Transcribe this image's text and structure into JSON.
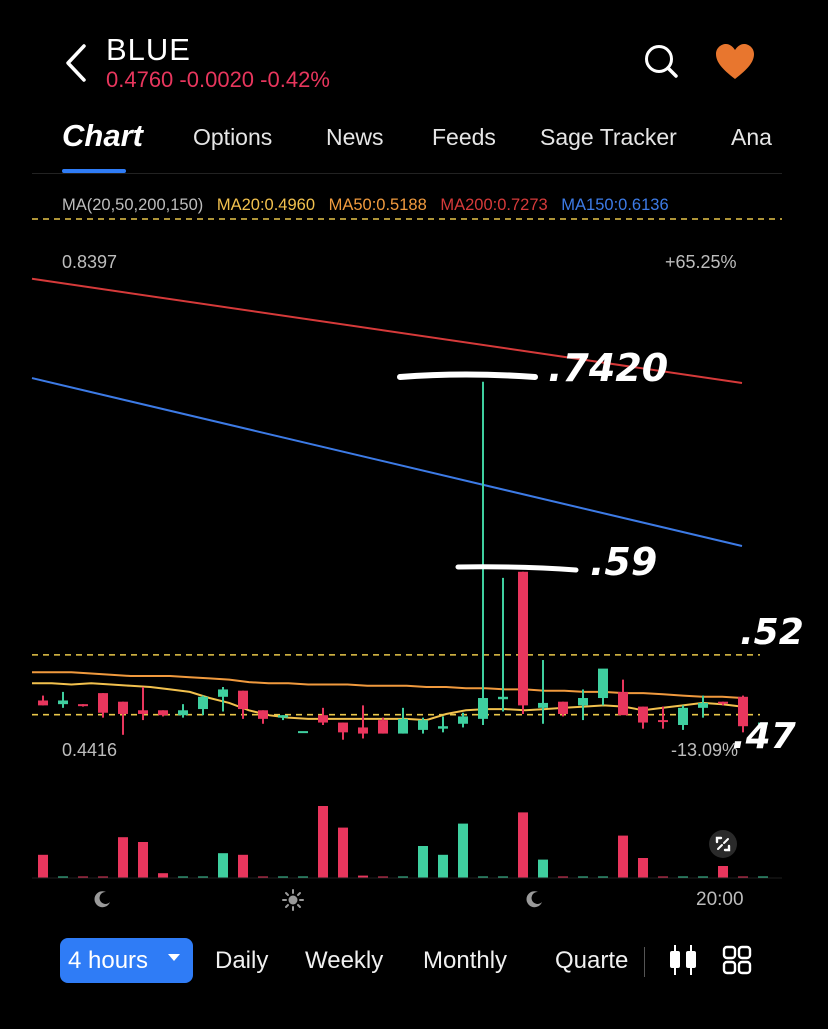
{
  "header": {
    "symbol": "BLUE",
    "price": "0.4760",
    "change": "-0.0020",
    "change_pct": "-0.42%",
    "price_color": "#e8365d"
  },
  "tabs": [
    "Chart",
    "Options",
    "News",
    "Feeds",
    "Sage Tracker",
    "Ana"
  ],
  "active_tab": "Chart",
  "ma_legend": {
    "params": "MA(20,50,200,150)",
    "ma20": "MA20:0.4960",
    "ma50": "MA50:0.5188",
    "ma200": "MA200:0.7273",
    "ma150": "MA150:0.6136",
    "colors": {
      "params": "#bdbdbd",
      "ma20": "#f2c14e",
      "ma50": "#f09a3e",
      "ma200": "#d63a3a",
      "ma150": "#3d7be6"
    }
  },
  "axis": {
    "high": "0.8397",
    "high_pct": "+65.25%",
    "low": "0.4416",
    "low_pct": "-13.09%",
    "time_label": "20:00"
  },
  "annotations": {
    "peak": ".7420",
    "mid": ".59",
    "resistance": ".52",
    "support": ".47"
  },
  "timeframes": {
    "active": "4 hours",
    "items": [
      "Daily",
      "Weekly",
      "Monthly",
      "Quarte"
    ]
  },
  "icons": [
    "back-icon",
    "search-icon",
    "heart-icon",
    "moon-icon",
    "sun-icon",
    "candle-style-icon",
    "grid-icon",
    "fullscreen-icon"
  ],
  "colors": {
    "up": "#3fcf9f",
    "down": "#e8365d",
    "accent": "#2f7cf6",
    "favorite": "#e8762e"
  },
  "chart_data": {
    "type": "candlestick",
    "y_range": [
      0.4416,
      0.8397
    ],
    "candles": [
      {
        "o": 0.482,
        "h": 0.486,
        "l": 0.478,
        "c": 0.478
      },
      {
        "o": 0.479,
        "h": 0.489,
        "l": 0.476,
        "c": 0.482
      },
      {
        "o": 0.479,
        "h": 0.479,
        "l": 0.477,
        "c": 0.478
      },
      {
        "o": 0.488,
        "h": 0.488,
        "l": 0.468,
        "c": 0.472
      },
      {
        "o": 0.481,
        "h": 0.481,
        "l": 0.454,
        "c": 0.471
      },
      {
        "o": 0.474,
        "h": 0.493,
        "l": 0.466,
        "c": 0.471
      },
      {
        "o": 0.474,
        "h": 0.474,
        "l": 0.469,
        "c": 0.47
      },
      {
        "o": 0.47,
        "h": 0.479,
        "l": 0.468,
        "c": 0.474
      },
      {
        "o": 0.475,
        "h": 0.486,
        "l": 0.47,
        "c": 0.485
      },
      {
        "o": 0.485,
        "h": 0.493,
        "l": 0.473,
        "c": 0.491
      },
      {
        "o": 0.49,
        "h": 0.49,
        "l": 0.467,
        "c": 0.475
      },
      {
        "o": 0.474,
        "h": 0.474,
        "l": 0.463,
        "c": 0.467
      },
      {
        "o": 0.468,
        "h": 0.47,
        "l": 0.466,
        "c": 0.47
      },
      {
        "o": 0.457,
        "h": 0.457,
        "l": 0.457,
        "c": 0.457
      },
      {
        "o": 0.47,
        "h": 0.476,
        "l": 0.462,
        "c": 0.464
      },
      {
        "o": 0.464,
        "h": 0.464,
        "l": 0.45,
        "c": 0.456
      },
      {
        "o": 0.46,
        "h": 0.478,
        "l": 0.451,
        "c": 0.455
      },
      {
        "o": 0.466,
        "h": 0.468,
        "l": 0.455,
        "c": 0.455
      },
      {
        "o": 0.455,
        "h": 0.476,
        "l": 0.455,
        "c": 0.467
      },
      {
        "o": 0.458,
        "h": 0.468,
        "l": 0.455,
        "c": 0.466
      },
      {
        "o": 0.459,
        "h": 0.469,
        "l": 0.456,
        "c": 0.461
      },
      {
        "o": 0.463,
        "h": 0.472,
        "l": 0.46,
        "c": 0.469
      },
      {
        "o": 0.467,
        "h": 0.742,
        "l": 0.462,
        "c": 0.484
      },
      {
        "o": 0.483,
        "h": 0.582,
        "l": 0.473,
        "c": 0.485
      },
      {
        "o": 0.587,
        "h": 0.587,
        "l": 0.471,
        "c": 0.478
      },
      {
        "o": 0.476,
        "h": 0.515,
        "l": 0.463,
        "c": 0.48
      },
      {
        "o": 0.481,
        "h": 0.481,
        "l": 0.469,
        "c": 0.471
      },
      {
        "o": 0.478,
        "h": 0.491,
        "l": 0.466,
        "c": 0.484
      },
      {
        "o": 0.484,
        "h": 0.505,
        "l": 0.478,
        "c": 0.508
      },
      {
        "o": 0.489,
        "h": 0.499,
        "l": 0.475,
        "c": 0.47
      },
      {
        "o": 0.477,
        "h": 0.477,
        "l": 0.459,
        "c": 0.464
      },
      {
        "o": 0.466,
        "h": 0.477,
        "l": 0.459,
        "c": 0.465
      },
      {
        "o": 0.462,
        "h": 0.478,
        "l": 0.458,
        "c": 0.476
      },
      {
        "o": 0.476,
        "h": 0.486,
        "l": 0.468,
        "c": 0.48
      },
      {
        "o": 0.481,
        "h": 0.481,
        "l": 0.478,
        "c": 0.48
      },
      {
        "o": 0.485,
        "h": 0.486,
        "l": 0.456,
        "c": 0.461
      },
      {
        "o": 0.464,
        "h": 0.464,
        "l": 0.464,
        "c": 0.464
      }
    ],
    "ma20": [
      0.496,
      0.496,
      0.495,
      0.496,
      0.495,
      0.494,
      0.493,
      0.491,
      0.489,
      0.484,
      0.48,
      0.474,
      0.47,
      0.468,
      0.467,
      0.467,
      0.467,
      0.467,
      0.467,
      0.467,
      0.466,
      0.471,
      0.474,
      0.475,
      0.475,
      0.474,
      0.475,
      0.476,
      0.477,
      0.478,
      0.477,
      0.474,
      0.476,
      0.478,
      0.48,
      0.479,
      0.477
    ],
    "ma50": [
      0.505,
      0.505,
      0.505,
      0.504,
      0.503,
      0.502,
      0.502,
      0.502,
      0.501,
      0.5,
      0.499,
      0.497,
      0.496,
      0.496,
      0.495,
      0.495,
      0.495,
      0.494,
      0.494,
      0.494,
      0.493,
      0.493,
      0.492,
      0.492,
      0.491,
      0.491,
      0.49,
      0.49,
      0.489,
      0.489,
      0.488,
      0.488,
      0.487,
      0.486,
      0.485,
      0.485,
      0.484
    ],
    "ma200": [
      0.826,
      0.741
    ],
    "ma150": [
      0.745,
      0.608
    ],
    "volume_heights": [
      0.29,
      0.01,
      0.01,
      0.01,
      0.51,
      0.45,
      0.06,
      0.01,
      0.01,
      0.31,
      0.29,
      0.01,
      0.01,
      0.01,
      0.9,
      0.63,
      0.03,
      0.01,
      0.01,
      0.4,
      0.29,
      0.68,
      0.01,
      0.01,
      0.82,
      0.23,
      0.01,
      0.01,
      0.01,
      0.53,
      0.25,
      0.01,
      0.01,
      0.01,
      0.15,
      0.01,
      0.01
    ],
    "support": 0.4704,
    "resistance": 0.5192
  }
}
